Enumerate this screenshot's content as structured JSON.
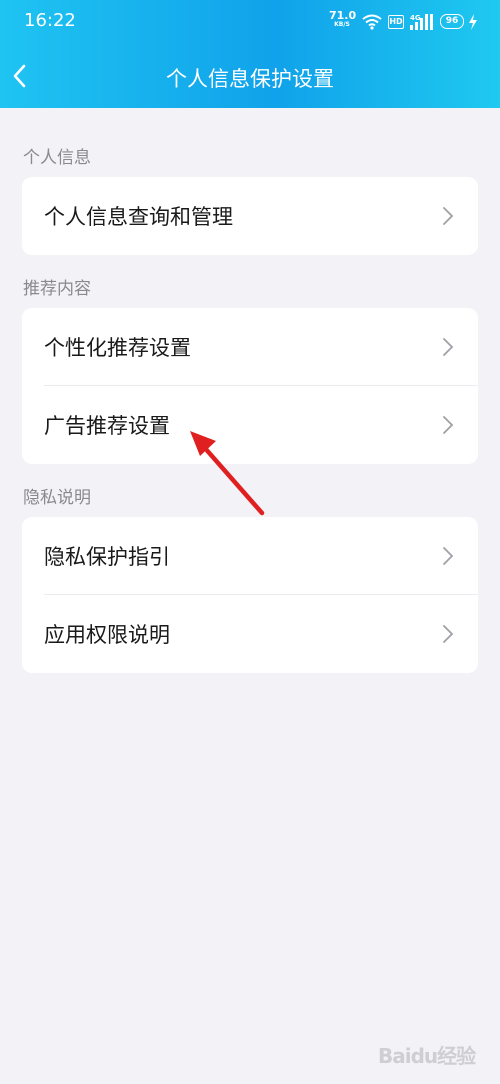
{
  "status_bar": {
    "time": "16:22",
    "net_speed": "71.0",
    "net_unit": "KB/S",
    "hd": "HD",
    "signal_label": "4G",
    "battery": "96"
  },
  "header": {
    "title": "个人信息保护设置",
    "back_icon": "chevron-left-icon"
  },
  "sections": [
    {
      "label": "个人信息",
      "items": [
        {
          "label": "个人信息查询和管理"
        }
      ]
    },
    {
      "label": "推荐内容",
      "items": [
        {
          "label": "个性化推荐设置"
        },
        {
          "label": "广告推荐设置"
        }
      ]
    },
    {
      "label": "隐私说明",
      "items": [
        {
          "label": "隐私保护指引"
        },
        {
          "label": "应用权限说明"
        }
      ]
    }
  ],
  "annotation": {
    "icon": "red-arrow-icon",
    "color": "#e02020"
  },
  "watermark": "Baidu经验",
  "colors": {
    "header_start": "#1fc4f2",
    "header_end": "#10a2ea",
    "background": "#f2f2f7"
  }
}
